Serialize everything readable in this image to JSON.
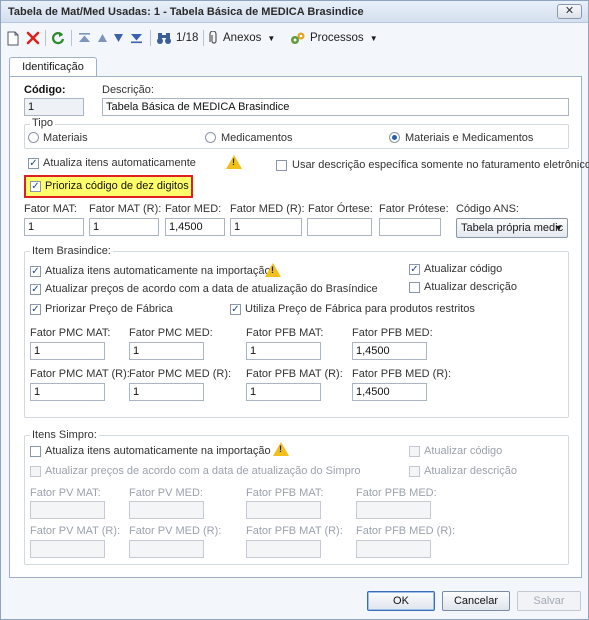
{
  "window": {
    "title": "Tabela de Mat/Med Usadas: 1 - Tabela Básica de MEDICA Brasindice",
    "close": "✕"
  },
  "toolbar": {
    "record_position": "1/18",
    "anexos_label": "Anexos",
    "processos_label": "Processos"
  },
  "tabs": [
    {
      "label": "Identificação"
    }
  ],
  "form": {
    "codigo_label": "Código:",
    "codigo_value": "1",
    "descricao_label": "Descrição:",
    "descricao_value": "Tabela Básica de MEDICA  Brasindice",
    "tipo": {
      "label": "Tipo",
      "options": [
        "Materiais",
        "Medicamentos",
        "Materiais e Medicamentos"
      ],
      "selected": "Materiais e Medicamentos"
    },
    "atualiza_itens_label": "Atualiza itens automaticamente",
    "usar_descricao_label": "Usar descrição específica somente no faturamento eletrônico",
    "prioriza_codigo_label": "Prioriza código de dez digitos",
    "fatores": [
      {
        "label": "Fator MAT:",
        "value": "1"
      },
      {
        "label": "Fator MAT (R):",
        "value": "1"
      },
      {
        "label": "Fator MED:",
        "value": "1,4500"
      },
      {
        "label": "Fator MED (R):",
        "value": "1"
      },
      {
        "label": "Fator Órtese:",
        "value": ""
      },
      {
        "label": "Fator Prótese:",
        "value": ""
      }
    ],
    "codigo_ans_label": "Código ANS:",
    "codigo_ans_value": "Tabela própria medic"
  },
  "brasindice": {
    "title": "Item Brasindice:",
    "atualiza_importacao": "Atualiza itens automaticamente na importação",
    "atualizar_precos": "Atualizar preços de acordo com a data de atualização do Brasíndice",
    "priorizar_preco": "Priorizar Preço de Fábrica",
    "utiliza_preco": "Utiliza Preço de Fábrica para produtos restritos",
    "atualizar_codigo": "Atualizar código",
    "atualizar_descricao": "Atualizar descrição",
    "fatores_row1": [
      {
        "label": "Fator PMC MAT:",
        "value": "1"
      },
      {
        "label": "Fator PMC MED:",
        "value": "1"
      },
      {
        "label": "Fator PFB MAT:",
        "value": "1"
      },
      {
        "label": "Fator PFB MED:",
        "value": "1,4500"
      }
    ],
    "fatores_row2": [
      {
        "label": "Fator PMC MAT (R):",
        "value": "1"
      },
      {
        "label": "Fator PMC MED (R):",
        "value": "1"
      },
      {
        "label": "Fator PFB MAT (R):",
        "value": "1"
      },
      {
        "label": "Fator PFB MED (R):",
        "value": "1,4500"
      }
    ]
  },
  "simpro": {
    "title": "Itens Simpro:",
    "atualiza_importacao": "Atualiza itens automaticamente na importação",
    "atualizar_precos": "Atualizar preços de acordo com a data de atualização do Simpro",
    "atualizar_codigo": "Atualizar código",
    "atualizar_descricao": "Atualizar descrição",
    "fatores_row1": [
      "Fator PV MAT:",
      "Fator PV MED:",
      "Fator PFB MAT:",
      "Fator PFB MED:"
    ],
    "fatores_row2": [
      "Fator PV MAT (R):",
      "Fator PV MED (R):",
      "Fator PFB MAT (R):",
      "Fator PFB MED (R):"
    ]
  },
  "buttons": {
    "ok": "OK",
    "cancelar": "Cancelar",
    "salvar": "Salvar"
  },
  "colors": {
    "highlight_fill": "#ffff6b",
    "highlight_border": "#e02020",
    "warning": "#f2c01a"
  }
}
